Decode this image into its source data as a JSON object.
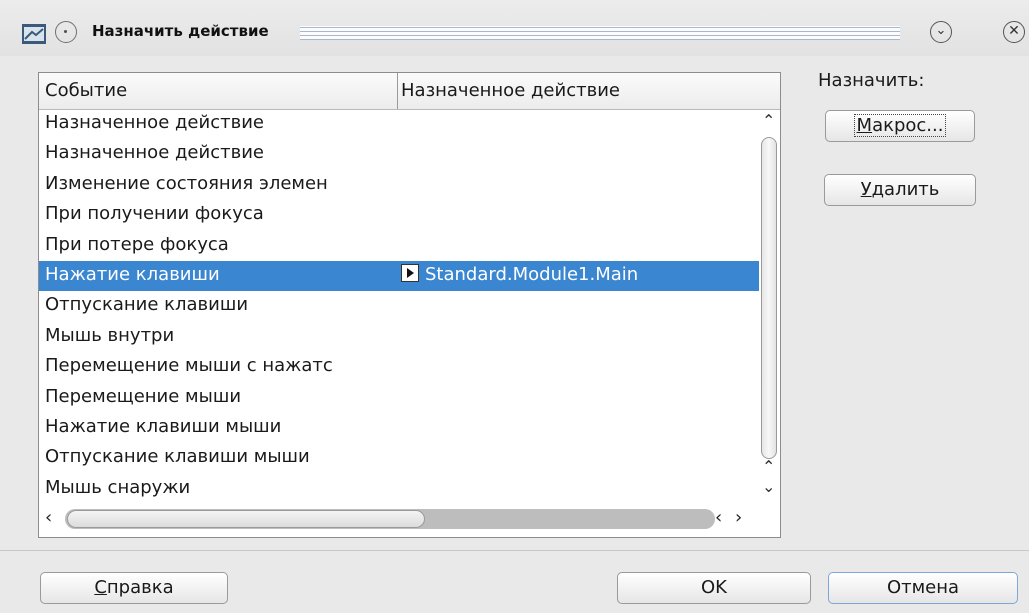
{
  "window": {
    "title": "Назначить действие",
    "menu_icon": "window-menu-icon",
    "minimize_glyph": "⌄",
    "close_glyph": "✕"
  },
  "list": {
    "columns": [
      "Событие",
      "Назначенное действие"
    ],
    "rows": [
      {
        "event": "Назначенное действие",
        "action": ""
      },
      {
        "event": "Назначенное действие",
        "action": ""
      },
      {
        "event": "Изменение состояния элемен",
        "action": ""
      },
      {
        "event": "При получении фокуса",
        "action": ""
      },
      {
        "event": "При потере фокуса",
        "action": ""
      },
      {
        "event": "Нажатие клавиши",
        "action": "Standard.Module1.Main",
        "selected": true
      },
      {
        "event": "Отпускание клавиши",
        "action": ""
      },
      {
        "event": "Мышь внутри",
        "action": ""
      },
      {
        "event": "Перемещение мыши с нажатс",
        "action": ""
      },
      {
        "event": "Перемещение мыши",
        "action": ""
      },
      {
        "event": "Нажатие клавиши мыши",
        "action": ""
      },
      {
        "event": "Отпускание клавиши мыши",
        "action": ""
      },
      {
        "event": "Мышь снаружи",
        "action": ""
      }
    ]
  },
  "assign": {
    "label": "Назначить:",
    "macro_button": "Макрос...",
    "delete_button": "Удалить"
  },
  "footer": {
    "help_button": "Справка",
    "ok_button": "OK",
    "cancel_button": "Отмена"
  },
  "colors": {
    "selection": "#3a86d0",
    "background": "#e9e9e9"
  }
}
